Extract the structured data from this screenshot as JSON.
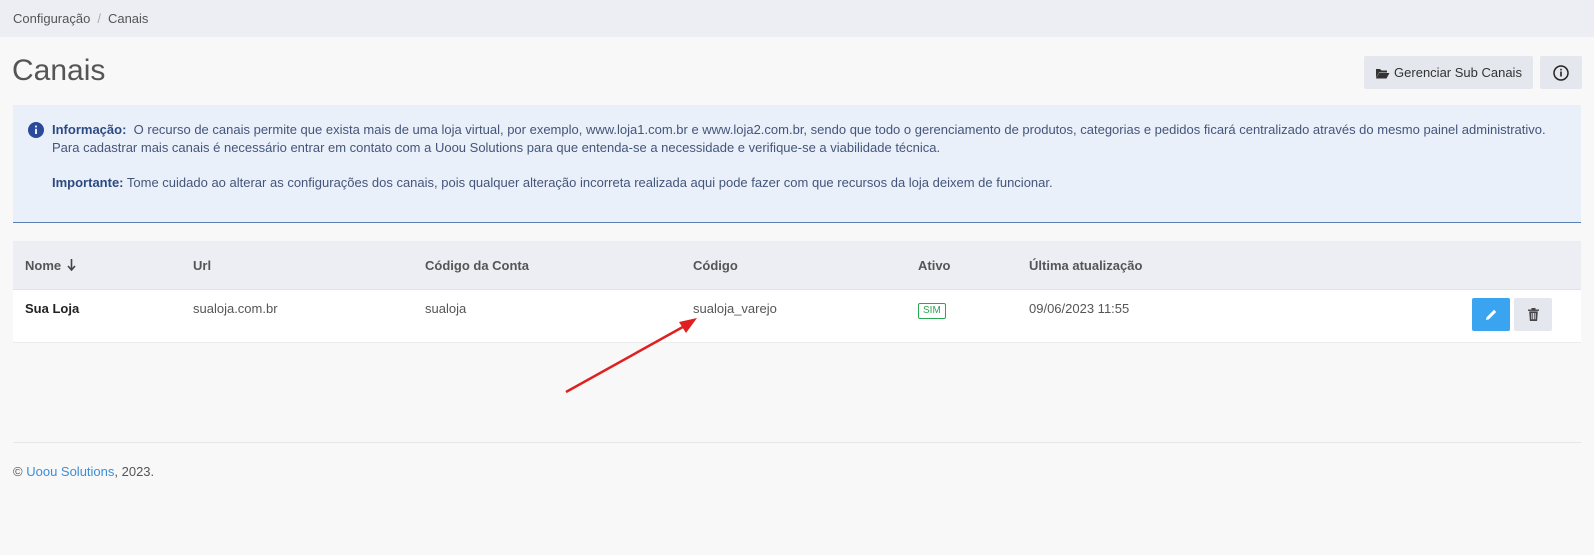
{
  "breadcrumb": {
    "items": [
      "Configuração",
      "Canais"
    ],
    "separator": "/"
  },
  "page": {
    "title": "Canais"
  },
  "toolbar": {
    "sub_channels_label": "Gerenciar Sub Canais",
    "sub_channels_icon": "folder-open-icon",
    "info_icon": "info-circle-icon"
  },
  "alert": {
    "info_label": "Informação:",
    "info_text": "O recurso de canais permite que exista mais de uma loja virtual, por exemplo, www.loja1.com.br e www.loja2.com.br, sendo que todo o gerenciamento de produtos, categorias e pedidos ficará centralizado através do mesmo painel administrativo.",
    "contact_text": "Para cadastrar mais canais é necessário entrar em contato com a Uoou Solutions para que entenda-se a necessidade e verifique-se a viabilidade técnica.",
    "important_label": "Importante:",
    "important_text": "Tome cuidado ao alterar as configurações dos canais, pois qualquer alteração incorreta realizada aqui pode fazer com que recursos da loja deixem de funcionar."
  },
  "table": {
    "columns": [
      "Nome",
      "Url",
      "Código da Conta",
      "Código",
      "Ativo",
      "Última atualização"
    ],
    "sort_icon": "arrow-down-icon",
    "rows": [
      {
        "nome": "Sua Loja",
        "url": "sualoja.com.br",
        "codigo_conta": "sualoja",
        "codigo": "sualoja_varejo",
        "ativo": "SIM",
        "atualizacao": "09/06/2023 11:55"
      }
    ]
  },
  "footer": {
    "copyright": "©",
    "company": "Uoou Solutions",
    "year": ", 2023."
  },
  "colors": {
    "accent": "#3aa4f0",
    "success": "#2aa653",
    "annotation": "#e02020"
  }
}
